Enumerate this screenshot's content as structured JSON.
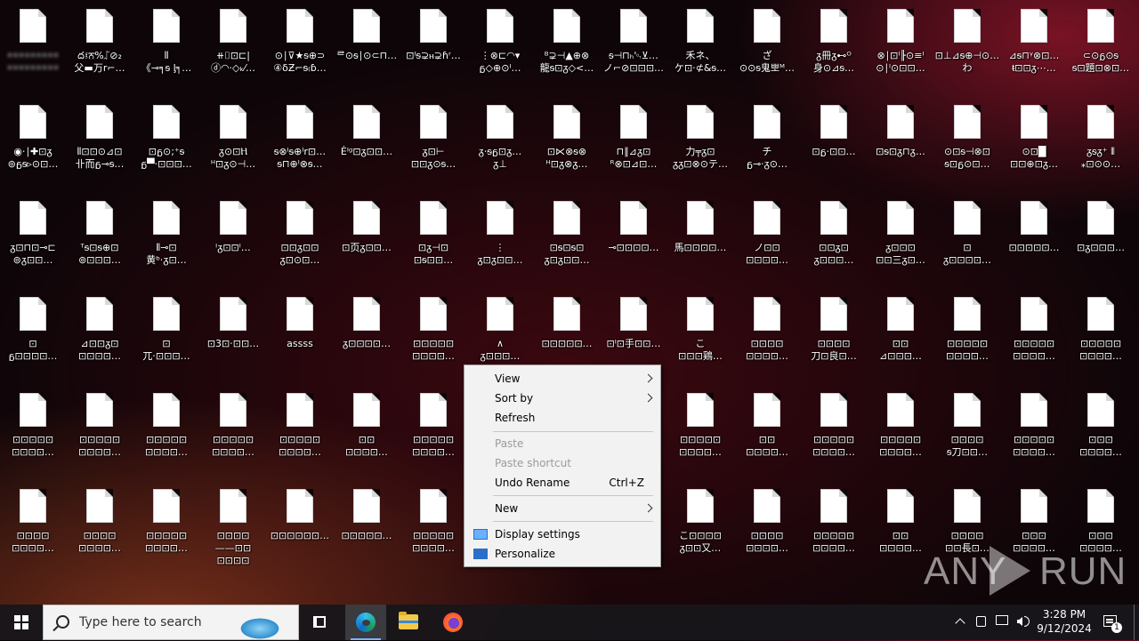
{
  "desktop": {
    "icons": [
      [
        "•••••••••\n•••••••••",
        "ద፤ਨ%ᛢ⊘₂\n父▬万r⌐…",
        "⦀\n《⊸╕ᵴ ᶅ╕…",
        "⧺⌷⊡⊏|\nⓓ◠⋅◇ₖ⁄…",
        "⊙∣⊽★ᵴ⊕⊃\n④δƵ⌐ᵴ₍ɓ…",
        "ᄅ⊙ᵴ∣⊙⊂⊓…",
        "⊡ᴵᵴ⊋ⲏ⊋ɦʳ…",
        "⋮⊗⊏◠▾\nᵷ◇⊕⊙ᴵ…",
        "ᴮ⊋⊣▲⊕⊗\n龍ᵴ⊡ᵹ◇<…",
        "ᵴ⊣⊓ₕ␄⊻…\nノ⌐⊘⊡⊡⊡…",
        "禾ネ、\nケ⊡⋅⊄&ᵴ…",
        "ざ\n⊙⊙ᵴ鬼뽀ᴹ…",
        "ᵹ冊ᵹ⊷ᴼ\n身⊙⊿ᵴ…",
        "⊗∣⊡ᴵ╟⊙≡ᴵ\n⊙∣ᴵ⊙⊡⊡…",
        "⊡⊥⊿ᵴ⊕⊣⊙…\nわ",
        "⊿ᵴ⊓ᵞ⊗⊡…\nᵵ⊡⊡ᵹ⋯…",
        "⊂⊙ᵷ⊙ᵴ\nᵴ⊡題⊡⊗⊡…"
      ],
      [
        "◉⋅∣✚⊡ᵹ\n⊚ᵷᵴ▹⊙⊡…",
        "⦀⊡⊡⊙⊿⊡\n卝而ᵷ⊸ᵴ…",
        "⊡ᵷ⊙;⁺ᵴ\nᵷ▀⋅⊡⊡⊡…",
        "ᵹ⊙⊡Ⲏ\nᴴ⊡ᵹ⊙⊣…",
        "ᵴ⊗ᴵᵴ⊕ᴵr⊡…\nᵴ⊓⊕ᴵ⊗ᵴ…",
        "Ėᴵᵍ⊡ᵹ⊡⊡…",
        "ᵹ⊡⊢\n⊡⊡ᵹ⊙ᵴ…",
        "ᵹ⋅ᵴᵷ⊡ᵹ…\nᵹ⊥",
        "⊡⋉⊗ᵴ⊗\nᴴ⊡ᵹ⊗ᵹ…",
        "⊓∥⊿ᵹ⊡\nᴿ⊗⊡⊿⊡…",
        "力╤ᵹ⊡\nᵹᵹ⊡⊗⊙テ…",
        "チ\nᵷ⊸⋅ᵹ⊙…",
        "⊡ᵷ⋅⊡⊡…",
        "⊡ᵴ⊡ᵹ⊓ᵹ…",
        "⊙⊡ᵴ⊣⊗⊡\nᵴ⊡ᵷ⊙⊡…",
        "⊙⊡█\n⊡⊡⊕⊡ᵹ…",
        "ᵹᵴᵹ⁺ ⦀\n⁎⊡⊙⊙…"
      ],
      [
        "ᵹ⊡⊓⊡⊸⊏\n⊚ᵹ⊡⊡…",
        "ᵀᵴ⊡ᵴ⊕⊡\n⊚⊡⊡⊡…",
        "⦀⊸⊡\n黄ᵇ⋅ᵹ⊡…",
        "ᴵᵹ⊡⊡ᴵ…",
        "⊡⊡ᵹ⊡⊡\nᵹ⊡⊙⊡…",
        "⊡页ᵹ⊡⊡…",
        "⊡ᵹ⊣⊡\n⊡ᵴ⊡⊡…",
        "⋮\nᵹ⊡ᵹ⊡⊡…",
        "⊡ᵴ⊡ᵴ⊡\nᵹ⊡ᵹ⊡⊡…",
        "⊸⊡⊡⊡⊡…",
        "馬⊡⊡⊡⊡…",
        "ノ⊡⊡\n⊡⊡⊡⊡…",
        "⊡⊡ᵹ⊡\nᵹ⊡⊡⊡…",
        "ᵹ⊡⊡⊡\n⊡⊡三ᵹ⊡…",
        "⊡\nᵹ⊡⊡⊡⊡…",
        "⊡⊡⊡⊡⊡…",
        "⊡ᵹ⊡⊡⊡…"
      ],
      [
        "⊡\nᵷ⊡⊡⊡⊡…",
        "⊿⊡⊡ᵹ⊡\n⊡⊡⊡⊡…",
        "⊡\n兀⋅⊡⊡⊡…",
        "⊡3⊡⋅⊡⊡…",
        "assss",
        "ᵹ⊡⊡⊡⊡…",
        "⊡⊡⊡⊡⊡\n⊡⊡⊡⊡…",
        "∧\nᵹ⊡⊡⊡…",
        "⊡⊡⊡⊡⊡…",
        "⊡ᴵ⊡手⊡⊡…",
        "こ\n⊡⊡⊡鶏…",
        "⊡⊡⊡⊡\n⊡⊡⊡⊡…",
        "⊡⊡⊡⊡\n刀⊡良⊡…",
        "⊡⊡\n⊿⊡⊡⊡…",
        "⊡⊡⊡⊡⊡\n⊡⊡⊡⊡…",
        "⊡⊡⊡⊡⊡\n⊡⊡⊡⊡…",
        "⊡⊡⊡⊡⊡\n⊡⊡⊡⊡…"
      ],
      [
        "⊡⊡⊡⊡⊡\n⊡⊡⊡⊡…",
        "⊡⊡⊡⊡⊡\n⊡⊡⊡⊡…",
        "⊡⊡⊡⊡⊡\n⊡⊡⊡⊡…",
        "⊡⊡⊡⊡⊡\n⊡⊡⊡⊡…",
        "⊡⊡⊡⊡⊡\n⊡⊡⊡⊡…",
        "⊡⊡\n⊡⊡⊡⊡…",
        "⊡⊡⊡⊡⊡\n⊡⊡⊡⊡…",
        "",
        "",
        "",
        "⊡⊡⊡⊡⊡\n⊡⊡⊡⊡…",
        "⊡⊡\n⊡⊡⊡⊡…",
        "⊡⊡⊡⊡⊡\n⊡⊡⊡⊡…",
        "⊡⊡⊡⊡⊡\n⊡⊡⊡⊡…",
        "⊡⊡⊡⊡\nᵴ刀⊡⊡…",
        "⊡⊡⊡⊡⊡\n⊡⊡⊡⊡…",
        "⊡⊡⊡\n⊡⊡⊡⊡…"
      ],
      [
        "⊡⊡⊡⊡\n⊡⊡⊡⊡…",
        "⊡⊡⊡⊡\n⊡⊡⊡⊡…",
        "⊡⊡⊡⊡⊡\n⊡⊡⊡⊡…",
        "⊡⊡⊡⊡\n——⊡⊡\n⊡⊡⊡⊡",
        "⊡⊡⊡⊡⊡⊡…",
        "⊡⊡⊡⊡⊡…",
        "⊡⊡⊡⊡⊡\n⊡⊡⊡⊡…",
        "",
        "",
        "",
        "こ⊡⊡⊡⊡\nᵹ⊡⊡又…",
        "⊡⊡⊡⊡\n⊡⊡⊡⊡…",
        "⊡⊡⊡⊡⊡\n⊡⊡⊡⊡…",
        "⊡⊡\n⊡⊡⊡⊡…",
        "⊡⊡⊡⊡\n⊡⊡長⊡…",
        "⊡⊡⊡\n⊡⊡⊡⊡…",
        "⊡⊡⊡\n⊡⊡⊡⊡…"
      ]
    ]
  },
  "context_menu": {
    "items": [
      {
        "label": "View",
        "shortcut": "",
        "disabled": false
      },
      {
        "label": "Sort by",
        "shortcut": "",
        "disabled": false
      },
      {
        "label": "Refresh",
        "shortcut": "",
        "disabled": false
      },
      {
        "label": "Paste",
        "shortcut": "",
        "disabled": true
      },
      {
        "label": "Paste shortcut",
        "shortcut": "",
        "disabled": true
      },
      {
        "label": "Undo Rename",
        "shortcut": "Ctrl+Z",
        "disabled": false
      },
      {
        "label": "New",
        "shortcut": "",
        "disabled": false
      },
      {
        "label": "Display settings",
        "shortcut": "",
        "disabled": false
      },
      {
        "label": "Personalize",
        "shortcut": "",
        "disabled": false
      }
    ]
  },
  "taskbar": {
    "search_placeholder": "Type here to search",
    "clock_time": "3:28 PM",
    "clock_date": "9/12/2024",
    "notification_count": "1"
  },
  "watermark": {
    "left": "ANY",
    "right": "RUN"
  },
  "colors": {
    "menu_background": "#f2f2f2",
    "taskbar_background": "#18161a",
    "accent": "#7ab8ff"
  }
}
